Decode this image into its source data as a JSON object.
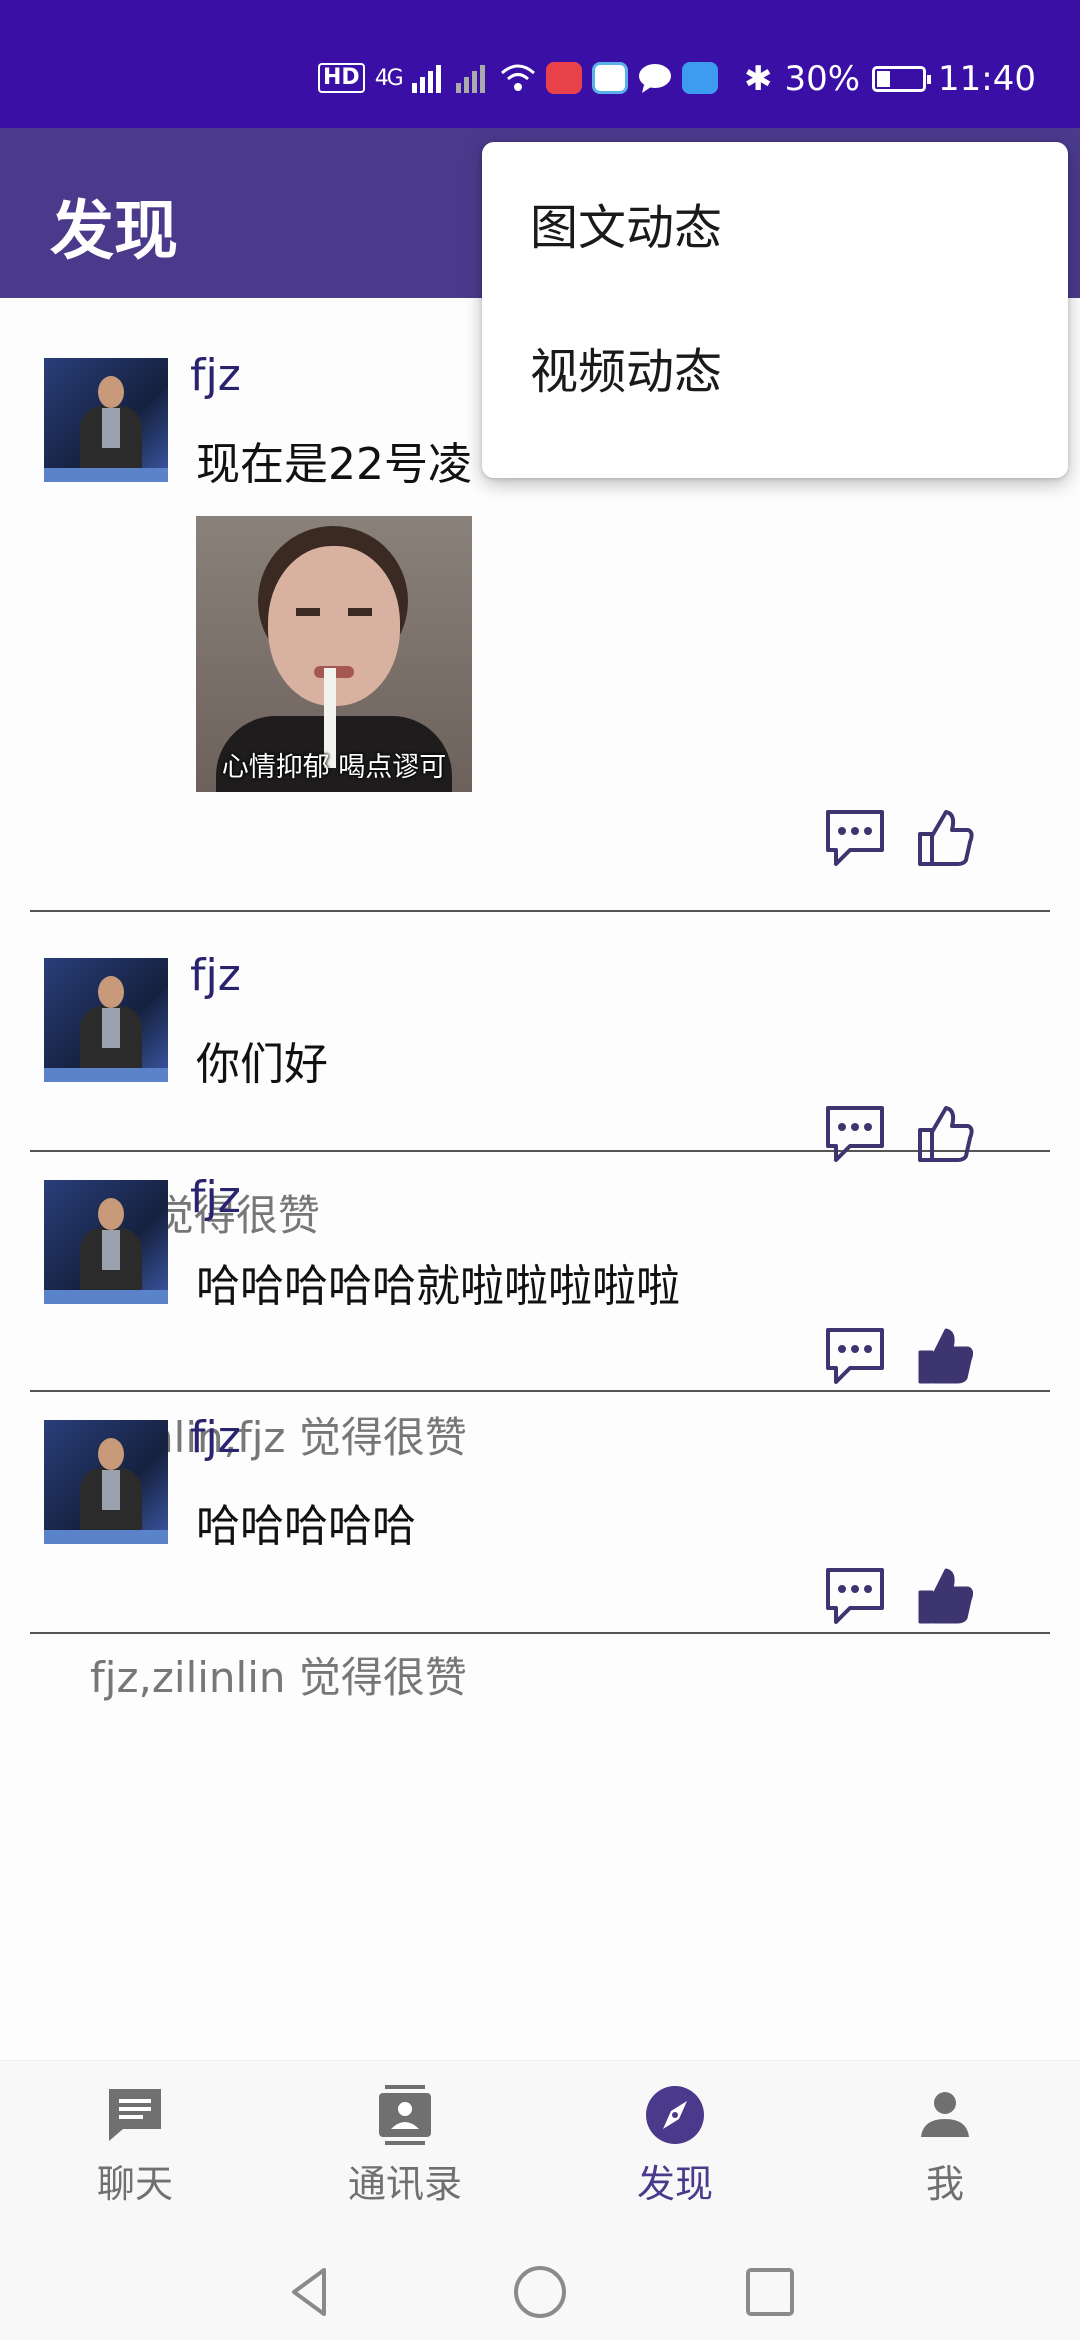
{
  "status_bar": {
    "hd": "HD",
    "network": "4G",
    "bluetooth": "✱",
    "battery": "30%",
    "battery_level": 0.3,
    "time": "11:40"
  },
  "app_bar": {
    "title": "发现"
  },
  "dropdown_menu": {
    "items": [
      {
        "label": "图文动态"
      },
      {
        "label": "视频动态"
      }
    ]
  },
  "posts": [
    {
      "username": "fjz",
      "content": "现在是22号凌",
      "image_caption": "心情抑郁 喝点谬可",
      "liked": false,
      "likes_text": ""
    },
    {
      "username": "fjz",
      "content": "你们好",
      "liked": false,
      "likes_text": "fjz 觉得很赞"
    },
    {
      "username": "fjz",
      "content": "哈哈哈哈哈就啦啦啦啦啦",
      "liked": true,
      "likes_text": "zilinlin,fjz 觉得很赞"
    },
    {
      "username": "fjz",
      "content": "哈哈哈哈哈",
      "liked": true,
      "likes_text": "fjz,zilinlin 觉得很赞"
    }
  ],
  "bottom_nav": {
    "items": [
      {
        "label": "聊天",
        "icon": "chat-icon"
      },
      {
        "label": "通讯录",
        "icon": "contacts-icon"
      },
      {
        "label": "发现",
        "icon": "compass-icon",
        "active": true
      },
      {
        "label": "我",
        "icon": "person-icon"
      }
    ]
  },
  "colors": {
    "status_bar": "#3a0fa6",
    "app_bar": "#4b3a8c",
    "accent": "#4b3a8c",
    "username": "#2a2470",
    "inactive_nav": "#707070"
  }
}
